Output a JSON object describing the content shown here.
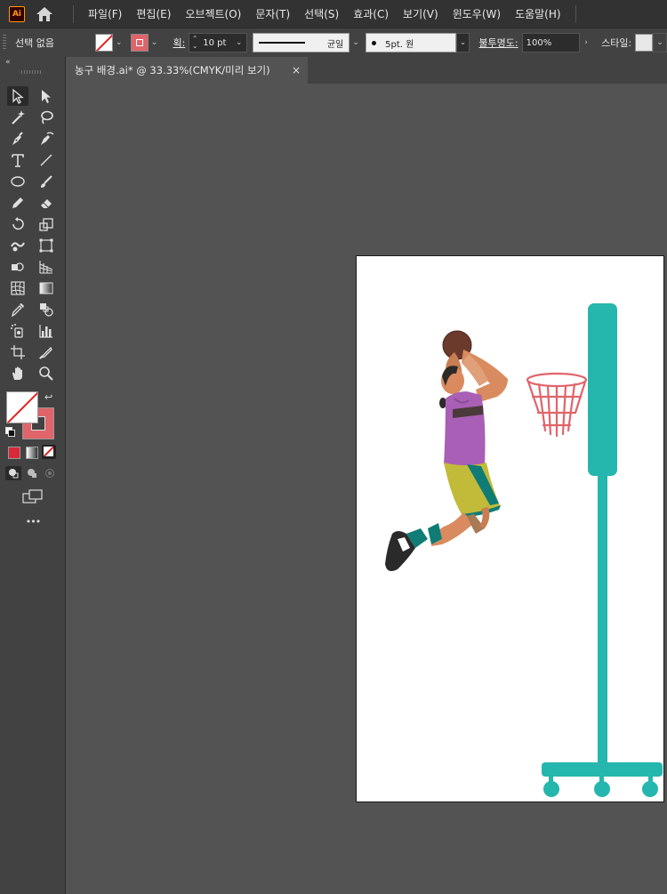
{
  "app": {
    "logo_text": "Ai",
    "menu": [
      "파일(F)",
      "편집(E)",
      "오브젝트(O)",
      "문자(T)",
      "선택(S)",
      "효과(C)",
      "보기(V)",
      "윈도우(W)",
      "도움말(H)"
    ]
  },
  "control": {
    "selection_status": "선택 없음",
    "stroke_label": "획:",
    "stroke_weight": "10 pt",
    "profile_label": "균일",
    "brush_label": "5pt. 원",
    "opacity_label": "불투명도:",
    "opacity_value": "100%",
    "style_label": "스타일:"
  },
  "document": {
    "tab_title": "농구 배경.ai* @ 33.33%(CMYK/미리 보기)",
    "close_glyph": "×"
  },
  "tools": {
    "more_label": "•••"
  },
  "colors": {
    "ui_dark": "#323232",
    "ui_panel": "#424242",
    "canvas_bg": "#535353",
    "stroke_swatch": "#e0646a",
    "teal": "#25b6ae",
    "hoop_red": "#e0646a"
  }
}
